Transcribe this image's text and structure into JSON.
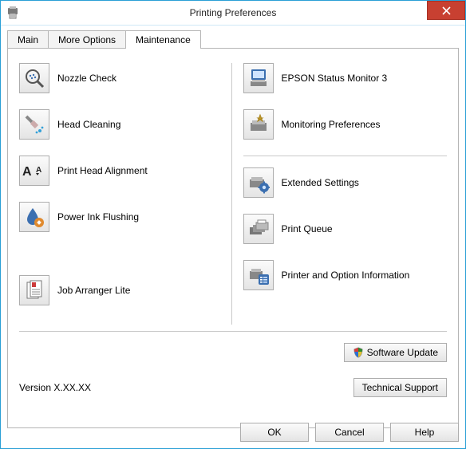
{
  "window": {
    "title": "Printing Preferences"
  },
  "tabs": {
    "main": "Main",
    "more": "More Options",
    "maint": "Maintenance"
  },
  "left": {
    "nozzle": "Nozzle Check",
    "head_cleaning": "Head Cleaning",
    "alignment": "Print Head Alignment",
    "power_ink": "Power Ink Flushing",
    "job_arranger": "Job Arranger Lite"
  },
  "right": {
    "status_monitor": "EPSON Status Monitor 3",
    "monitor_prefs": "Monitoring Preferences",
    "extended": "Extended Settings",
    "print_queue": "Print Queue",
    "printer_info": "Printer and Option Information"
  },
  "software_update": "Software Update",
  "version_label": "Version  X.XX.XX",
  "tech_support": "Technical Support",
  "buttons": {
    "ok": "OK",
    "cancel": "Cancel",
    "help": "Help"
  }
}
